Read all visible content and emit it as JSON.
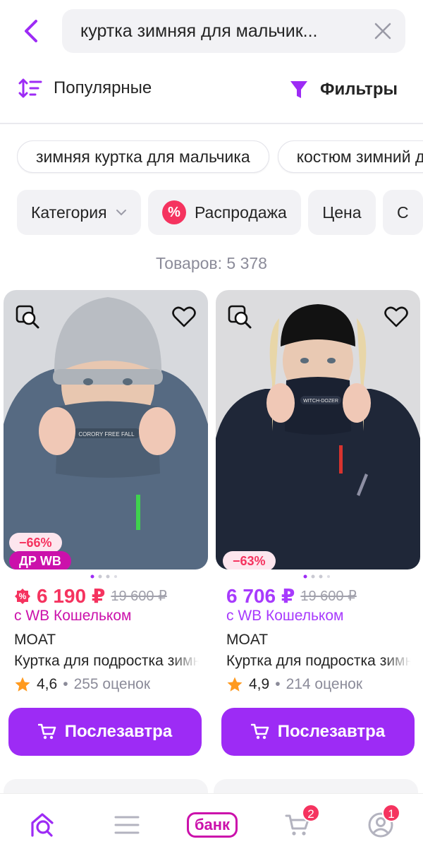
{
  "search": {
    "query": "куртка зимняя для мальчик..."
  },
  "sort": {
    "label": "Популярные"
  },
  "filters": {
    "label": "Фильтры"
  },
  "suggestions": [
    "зимняя куртка для мальчика",
    "костюм зимний для мальчика"
  ],
  "facets": {
    "category": "Категория",
    "sale": "Распродажа",
    "price": "Цена",
    "more": "С"
  },
  "results_count": "Товаров: 5 378",
  "products": [
    {
      "discount": "−66%",
      "promo_badge": "ДР WB",
      "price": "6 190 ₽",
      "old_price": "19 600 ₽",
      "wallet_note": "с WB Кошельком",
      "brand": "MOAT",
      "name": "Куртка для подростка зимняя",
      "rating": "4,6",
      "reviews": "255 оценок",
      "buy_label": "Послезавтра",
      "scarf_text": "CORORY FREE FALL"
    },
    {
      "discount": "−63%",
      "price": "6 706 ₽",
      "old_price": "19 600 ₽",
      "wallet_note": "с WB Кошельком",
      "brand": "MOAT",
      "name": "Куртка для подростка зимняя",
      "rating": "4,9",
      "reviews": "214 оценок",
      "buy_label": "Послезавтра",
      "scarf_text": "WITCH-DOZER"
    }
  ],
  "nav": {
    "bank_label": "банк",
    "cart_badge": "2",
    "profile_badge": "1"
  },
  "colors": {
    "accent": "#9d2bf5",
    "sale": "#f5335f",
    "wallet_text": "#cb11ab",
    "price_purple": "#a73afd"
  }
}
